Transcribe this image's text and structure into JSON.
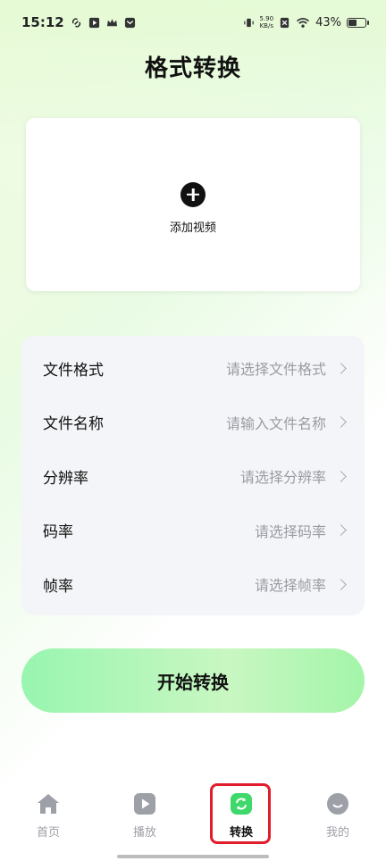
{
  "status_bar": {
    "time": "15:12",
    "net_speed_value": "5.90",
    "net_speed_unit": "KB/s",
    "battery": "43%"
  },
  "page_title": "格式转换",
  "add_video": {
    "label": "添加视频"
  },
  "settings": [
    {
      "label": "文件格式",
      "value": "请选择文件格式"
    },
    {
      "label": "文件名称",
      "value": "请输入文件名称"
    },
    {
      "label": "分辨率",
      "value": "请选择分辨率"
    },
    {
      "label": "码率",
      "value": "请选择码率"
    },
    {
      "label": "帧率",
      "value": "请选择帧率"
    }
  ],
  "start_button": "开始转换",
  "tabs": [
    {
      "label": "首页",
      "icon": "home-icon",
      "active": false
    },
    {
      "label": "播放",
      "icon": "play-icon",
      "active": false
    },
    {
      "label": "转换",
      "icon": "convert-icon",
      "active": true
    },
    {
      "label": "我的",
      "icon": "profile-icon",
      "active": false
    }
  ],
  "colors": {
    "accent_green": "#3fd86a",
    "highlight_red": "#e21d2b",
    "inactive_gray": "#9da0a6"
  }
}
